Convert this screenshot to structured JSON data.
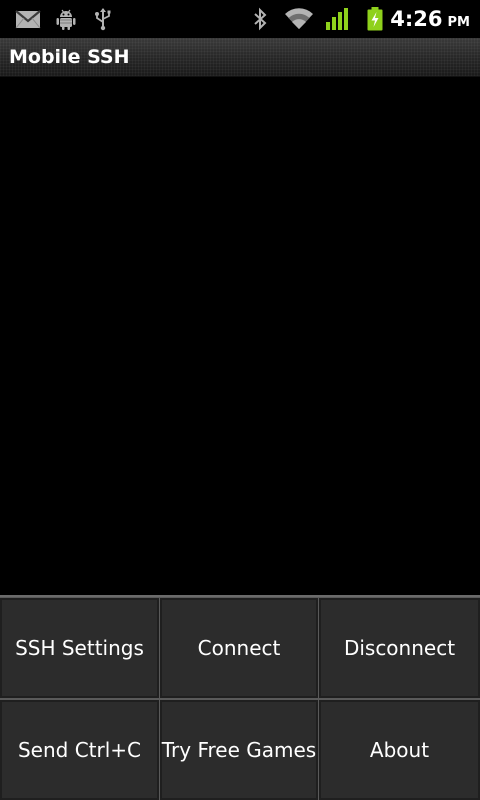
{
  "status_bar": {
    "time": "4:26",
    "ampm": "PM",
    "icons": [
      "gmail-icon",
      "android-debug-icon",
      "usb-icon",
      "bluetooth-icon",
      "wifi-icon",
      "signal-icon",
      "battery-charging-icon"
    ],
    "colors": {
      "signal": "#8fd11c",
      "battery": "#8fd11c"
    }
  },
  "app": {
    "title": "Mobile SSH"
  },
  "menu": {
    "ssh_settings": "SSH Settings",
    "connect": "Connect",
    "disconnect": "Disconnect",
    "send_ctrl_c": "Send Ctrl+C",
    "try_free_games": "Try Free Games",
    "about": "About"
  }
}
